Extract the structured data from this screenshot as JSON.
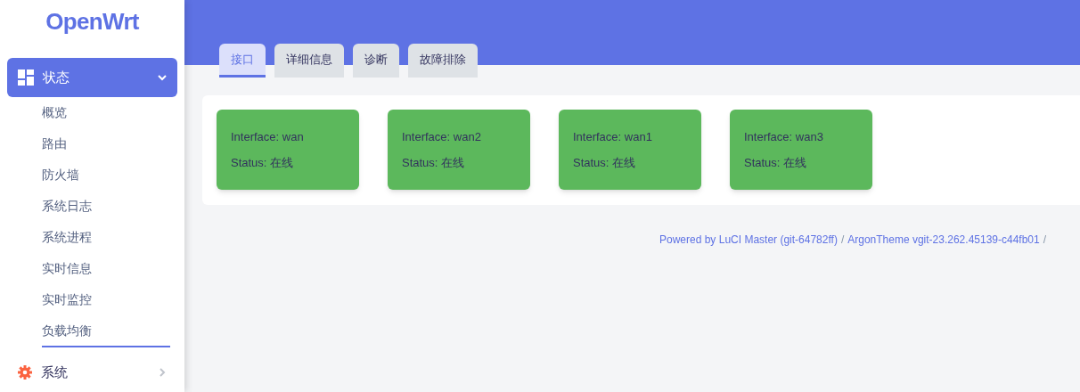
{
  "logo": "OpenWrt",
  "sidebar": {
    "groups": [
      {
        "label": "状态",
        "expanded": true,
        "selected": true,
        "items": [
          {
            "label": "概览",
            "selected": false
          },
          {
            "label": "路由",
            "selected": false
          },
          {
            "label": "防火墙",
            "selected": false
          },
          {
            "label": "系统日志",
            "selected": false
          },
          {
            "label": "系统进程",
            "selected": false
          },
          {
            "label": "实时信息",
            "selected": false
          },
          {
            "label": "实时监控",
            "selected": false
          },
          {
            "label": "负载均衡",
            "selected": true
          }
        ]
      },
      {
        "label": "系统",
        "expanded": false,
        "selected": false
      }
    ]
  },
  "tabs": [
    {
      "label": "接口",
      "selected": true
    },
    {
      "label": "详细信息",
      "selected": false
    },
    {
      "label": "诊断",
      "selected": false
    },
    {
      "label": "故障排除",
      "selected": false
    }
  ],
  "interfaces": [
    {
      "interface": "Interface: wan",
      "status": "Status: 在线",
      "color": "#5cb85c"
    },
    {
      "interface": "Interface: wan2",
      "status": "Status: 在线",
      "color": "#5cb85c"
    },
    {
      "interface": "Interface: wan1",
      "status": "Status: 在线",
      "color": "#5cb85c"
    },
    {
      "interface": "Interface: wan3",
      "status": "Status: 在线",
      "color": "#5cb85c"
    }
  ],
  "footer": {
    "parts": [
      {
        "kind": "link",
        "text": "Powered by LuCI Master (git-64782ff)"
      },
      {
        "kind": "sep",
        "text": "/"
      },
      {
        "kind": "link",
        "text": "ArgonTheme vgit-23.262.45139-c44fb01"
      },
      {
        "kind": "sep",
        "text": "/"
      }
    ]
  }
}
